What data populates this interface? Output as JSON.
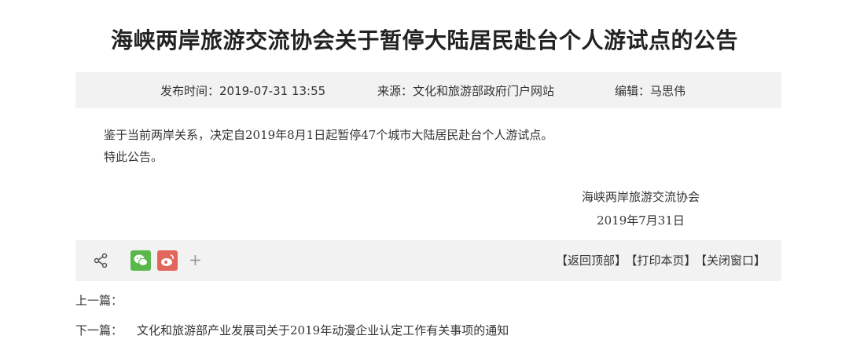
{
  "article": {
    "title": "海峡两岸旅游交流协会关于暂停大陆居民赴台个人游试点的公告",
    "meta": {
      "publish_time": "发布时间：2019-07-31 13:55",
      "source": "来源：文化和旅游部政府门户网站",
      "editor": "编辑：马思伟"
    },
    "body": [
      "鉴于当前两岸关系，决定自2019年8月1日起暂停47个城市大陆居民赴台个人游试点。",
      "特此公告。"
    ],
    "signature": {
      "org": "海峡两岸旅游交流协会",
      "date": "2019年7月31日"
    }
  },
  "share_bar": {
    "icons": [
      "share-icon",
      "wechat-icon",
      "weibo-icon",
      "plus-icon"
    ],
    "plus_label": "+",
    "actions": {
      "back_to_top": "【返回顶部】",
      "print": "【打印本页】",
      "close": "【关闭窗口】"
    },
    "colors": {
      "wechat": "#5ab84b",
      "weibo": "#e3665a",
      "bar_bg": "#f2f2f2"
    }
  },
  "navigation": {
    "prev_label": "上一篇：",
    "next_label": "下一篇：",
    "next_title": "文化和旅游部产业发展司关于2019年动漫企业认定工作有关事项的通知"
  }
}
